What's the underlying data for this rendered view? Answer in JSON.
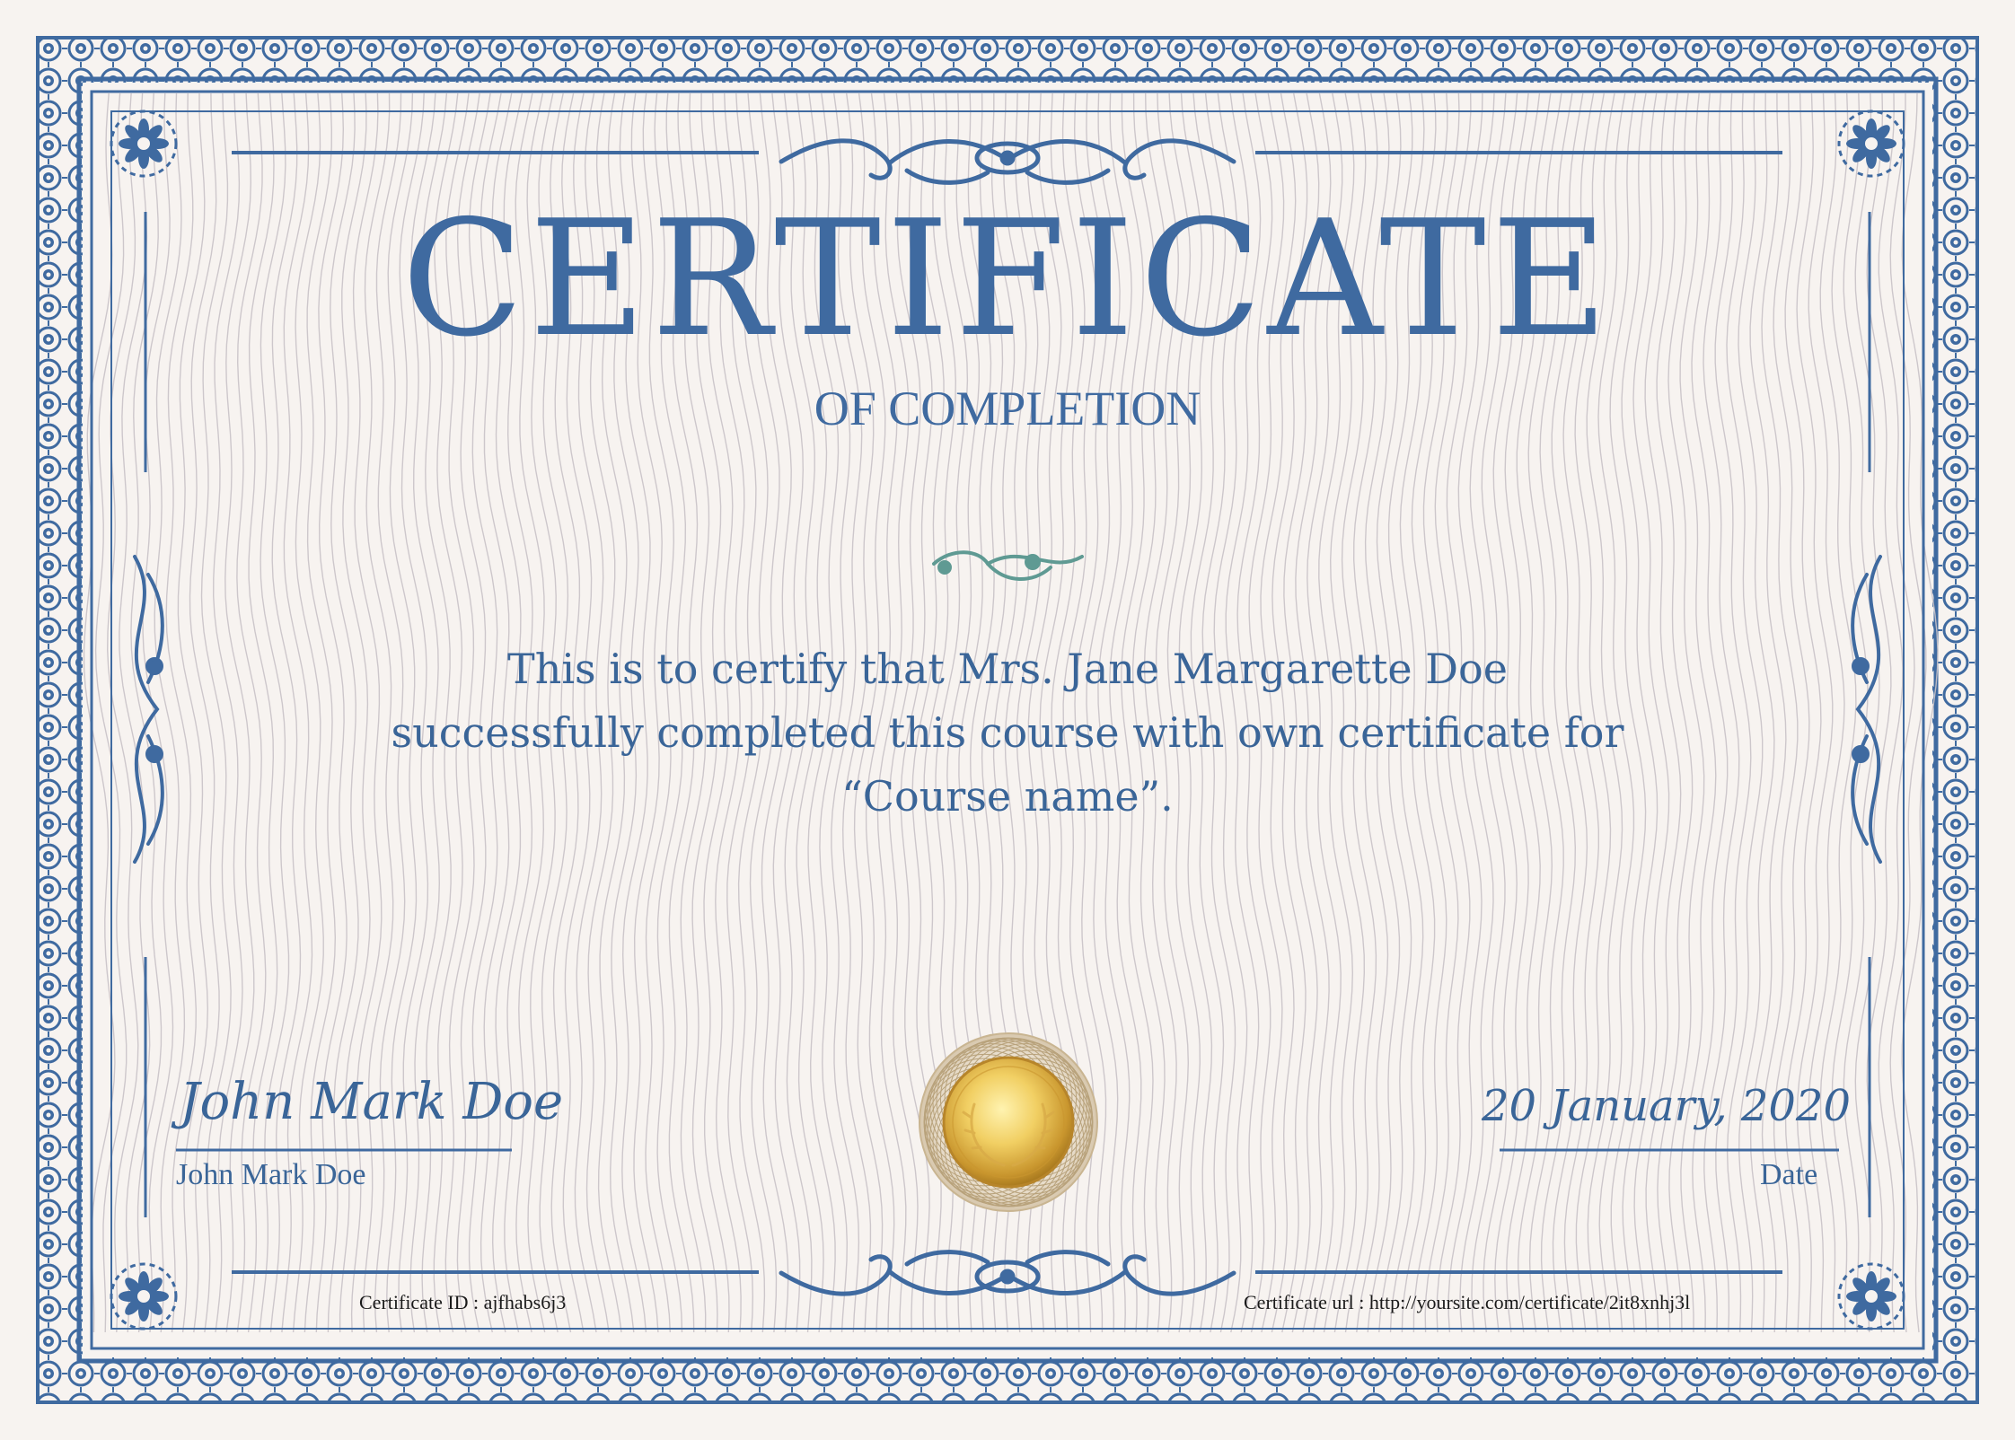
{
  "certificate": {
    "title": "CERTIFICATE",
    "subtitle": "OF COMPLETION",
    "body_line1": "This is to certify that Mrs. Jane Margarette Doe",
    "body_line2": "successfully completed this course with own certificate for",
    "body_line3": "“Course name”."
  },
  "signature": {
    "script_name": "John Mark Doe",
    "caption": "John Mark Doe"
  },
  "date": {
    "script_value": "20 January, 2020",
    "caption": "Date"
  },
  "footer": {
    "certificate_id": "Certificate ID : ajfhabs6j3",
    "certificate_url": "Certificate url : http://yoursite.com/certificate/2it8xnhj3l"
  },
  "colors": {
    "primary": "#3f6aa0",
    "accent_teal": "#5f9a93",
    "gold": "#e0b84a",
    "paper": "#f7f3f0"
  },
  "icons": {
    "seal": "gold-seal-with-laurel",
    "corners": "floral-corner-ornament",
    "top_center": "scroll-ornament",
    "bottom_center": "scroll-ornament",
    "middle": "swirl-divider",
    "sides": "flourish-ornament"
  }
}
